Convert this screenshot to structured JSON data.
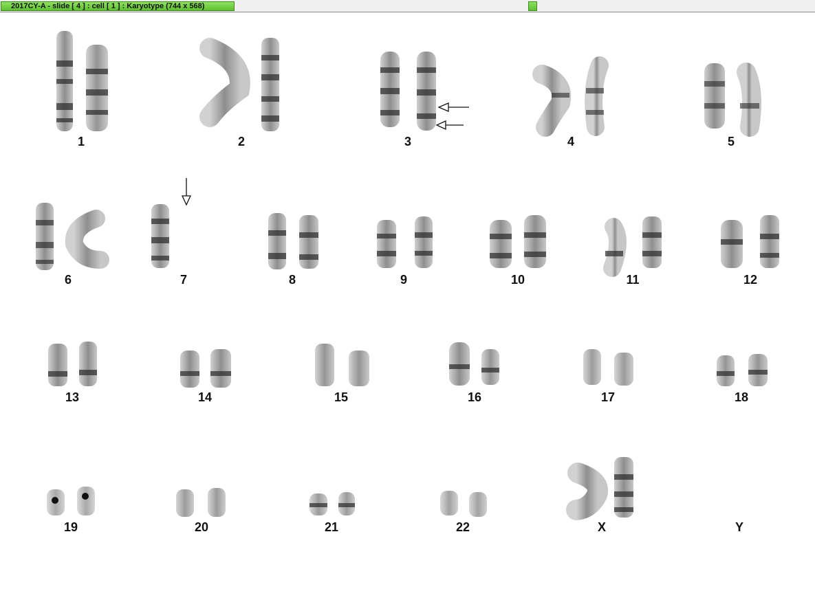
{
  "window": {
    "title": "2017CY-A - slide [ 4 ] : cell [ 1 ] : Karyotype  (744 x 568)"
  },
  "karyotype": {
    "labels": [
      "1",
      "2",
      "3",
      "4",
      "5",
      "6",
      "7",
      "8",
      "9",
      "10",
      "11",
      "12",
      "13",
      "14",
      "15",
      "16",
      "17",
      "18",
      "19",
      "20",
      "21",
      "22",
      "X",
      "Y"
    ]
  }
}
